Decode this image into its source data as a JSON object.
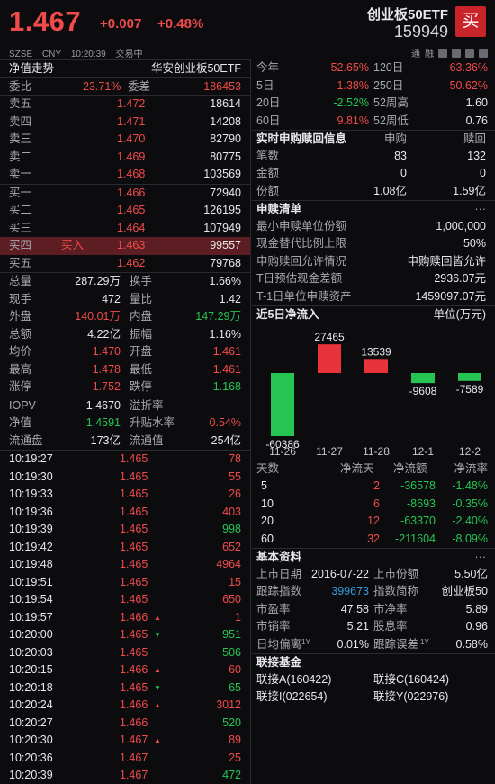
{
  "header": {
    "price": "1.467",
    "change": "+0.007",
    "change_pct": "+0.48%",
    "exchange": "SZSE",
    "currency": "CNY",
    "time": "10:20:39",
    "status": "交易中",
    "name": "创业板50ETF",
    "code": "159949",
    "buy_label": "买",
    "tools": [
      "通",
      "融"
    ]
  },
  "left": {
    "nav_title": "净值走势",
    "nav_fund": "华安创业板50ETF",
    "weibi": {
      "label": "委比",
      "value": "23.71%",
      "label2": "委差",
      "value2": "186453"
    },
    "sells": [
      {
        "label": "卖五",
        "price": "1.472",
        "vol": "18614"
      },
      {
        "label": "卖四",
        "price": "1.471",
        "vol": "14208"
      },
      {
        "label": "卖三",
        "price": "1.470",
        "vol": "82790"
      },
      {
        "label": "卖二",
        "price": "1.469",
        "vol": "80775"
      },
      {
        "label": "卖一",
        "price": "1.468",
        "vol": "103569"
      }
    ],
    "buys": [
      {
        "label": "买一",
        "tag": "",
        "price": "1.466",
        "vol": "72940"
      },
      {
        "label": "买二",
        "tag": "",
        "price": "1.465",
        "vol": "126195"
      },
      {
        "label": "买三",
        "tag": "",
        "price": "1.464",
        "vol": "107949"
      },
      {
        "label": "买四",
        "tag": "买入",
        "price": "1.463",
        "vol": "99557"
      },
      {
        "label": "买五",
        "tag": "",
        "price": "1.462",
        "vol": "79768"
      }
    ],
    "stats": [
      {
        "l1": "总量",
        "v1": "287.29万",
        "c1": "white",
        "l2": "换手",
        "v2": "1.66%",
        "c2": "white"
      },
      {
        "l1": "现手",
        "v1": "472",
        "c1": "white",
        "l2": "量比",
        "v2": "1.42",
        "c2": "white"
      },
      {
        "l1": "外盘",
        "v1": "140.01万",
        "c1": "red",
        "l2": "内盘",
        "v2": "147.29万",
        "c2": "green"
      },
      {
        "l1": "总额",
        "v1": "4.22亿",
        "c1": "white",
        "l2": "振幅",
        "v2": "1.16%",
        "c2": "white"
      },
      {
        "l1": "均价",
        "v1": "1.470",
        "c1": "red",
        "l2": "开盘",
        "v2": "1.461",
        "c2": "red"
      },
      {
        "l1": "最高",
        "v1": "1.478",
        "c1": "red",
        "l2": "最低",
        "v2": "1.461",
        "c2": "red"
      },
      {
        "l1": "涨停",
        "v1": "1.752",
        "c1": "red",
        "l2": "跌停",
        "v2": "1.168",
        "c2": "green"
      }
    ],
    "iopv": [
      {
        "l1": "IOPV",
        "v1": "1.4670",
        "c1": "white",
        "l2": "溢折率",
        "v2": "-",
        "c2": "white"
      },
      {
        "l1": "净值",
        "v1": "1.4591",
        "c1": "green",
        "l2": "升贴水率",
        "v2": "0.54%",
        "c2": "red"
      },
      {
        "l1": "流通盘",
        "v1": "173亿",
        "c1": "white",
        "l2": "流通值",
        "v2": "254亿",
        "c2": "white"
      }
    ],
    "ticks": [
      {
        "time": "10:19:27",
        "price": "1.465",
        "arrow": "",
        "vol": "78",
        "vc": "red"
      },
      {
        "time": "10:19:30",
        "price": "1.465",
        "arrow": "",
        "vol": "55",
        "vc": "red"
      },
      {
        "time": "10:19:33",
        "price": "1.465",
        "arrow": "",
        "vol": "26",
        "vc": "red"
      },
      {
        "time": "10:19:36",
        "price": "1.465",
        "arrow": "",
        "vol": "403",
        "vc": "red"
      },
      {
        "time": "10:19:39",
        "price": "1.465",
        "arrow": "",
        "vol": "998",
        "vc": "green"
      },
      {
        "time": "10:19:42",
        "price": "1.465",
        "arrow": "",
        "vol": "652",
        "vc": "red"
      },
      {
        "time": "10:19:48",
        "price": "1.465",
        "arrow": "",
        "vol": "4964",
        "vc": "red"
      },
      {
        "time": "10:19:51",
        "price": "1.465",
        "arrow": "",
        "vol": "15",
        "vc": "red"
      },
      {
        "time": "10:19:54",
        "price": "1.465",
        "arrow": "",
        "vol": "650",
        "vc": "red"
      },
      {
        "time": "10:19:57",
        "price": "1.466",
        "arrow": "up",
        "vol": "1",
        "vc": "red"
      },
      {
        "time": "10:20:00",
        "price": "1.465",
        "arrow": "down",
        "vol": "951",
        "vc": "green"
      },
      {
        "time": "10:20:03",
        "price": "1.465",
        "arrow": "",
        "vol": "506",
        "vc": "green"
      },
      {
        "time": "10:20:15",
        "price": "1.466",
        "arrow": "up",
        "vol": "60",
        "vc": "red"
      },
      {
        "time": "10:20:18",
        "price": "1.465",
        "arrow": "down",
        "vol": "65",
        "vc": "green"
      },
      {
        "time": "10:20:24",
        "price": "1.466",
        "arrow": "up",
        "vol": "3012",
        "vc": "red"
      },
      {
        "time": "10:20:27",
        "price": "1.466",
        "arrow": "",
        "vol": "520",
        "vc": "green"
      },
      {
        "time": "10:20:30",
        "price": "1.467",
        "arrow": "up",
        "vol": "89",
        "vc": "red"
      },
      {
        "time": "10:20:36",
        "price": "1.467",
        "arrow": "",
        "vol": "25",
        "vc": "red"
      },
      {
        "time": "10:20:39",
        "price": "1.467",
        "arrow": "",
        "vol": "472",
        "vc": "green"
      }
    ]
  },
  "right": {
    "perf": [
      {
        "l1": "今年",
        "v1": "52.65%",
        "c1": "red",
        "l2": "120日",
        "v2": "63.36%",
        "c2": "red"
      },
      {
        "l1": "5日",
        "v1": "1.38%",
        "c1": "red",
        "l2": "250日",
        "v2": "50.62%",
        "c2": "red"
      },
      {
        "l1": "20日",
        "v1": "-2.52%",
        "c1": "green",
        "l2": "52周高",
        "v2": "1.60",
        "c2": "white"
      },
      {
        "l1": "60日",
        "v1": "9.81%",
        "c1": "red",
        "l2": "52周低",
        "v2": "0.76",
        "c2": "white"
      }
    ],
    "realtime": {
      "title": "实时申购赎回信息",
      "col1": "申购",
      "col2": "赎回",
      "rows": [
        {
          "label": "笔数",
          "v1": "83",
          "v2": "132"
        },
        {
          "label": "金额",
          "v1": "0",
          "v2": "0"
        },
        {
          "label": "份额",
          "v1": "1.08亿",
          "v2": "1.59亿"
        }
      ]
    },
    "list": {
      "title": "申赎清单",
      "more": "···",
      "rows": [
        {
          "label": "最小申赎单位份额",
          "value": "1,000,000"
        },
        {
          "label": "现金替代比例上限",
          "value": "50%"
        },
        {
          "label": "申购赎回允许情况",
          "value": "申购赎回皆允许"
        },
        {
          "label": "T日预估现金差额",
          "value": "2936.07元"
        },
        {
          "label": "T-1日单位申赎资产",
          "value": "1459097.07元"
        }
      ]
    },
    "flow": {
      "title": "近5日净流入",
      "unit": "单位(万元)"
    },
    "flow_table": {
      "headers": [
        "天数",
        "净流天",
        "净流额",
        "净流率"
      ],
      "rows": [
        {
          "days": "5",
          "n": "2",
          "amt": "-36578",
          "rate": "-1.48%"
        },
        {
          "days": "10",
          "n": "6",
          "amt": "-8693",
          "rate": "-0.35%"
        },
        {
          "days": "20",
          "n": "12",
          "amt": "-63370",
          "rate": "-2.40%"
        },
        {
          "days": "60",
          "n": "32",
          "amt": "-211604",
          "rate": "-8.09%"
        }
      ]
    },
    "basic": {
      "title": "基本资料",
      "more": "···",
      "rows": [
        {
          "l1": "上市日期",
          "v1": "2016-07-22",
          "c1": "white",
          "l2": "上市份额",
          "v2": "5.50亿",
          "c2": "white",
          "s1": "",
          "s2": ""
        },
        {
          "l1": "跟踪指数",
          "v1": "399673",
          "c1": "blue",
          "l2": "指数简称",
          "v2": "创业板50",
          "c2": "white",
          "s1": "",
          "s2": ""
        },
        {
          "l1": "市盈率",
          "v1": "47.58",
          "c1": "white",
          "l2": "市净率",
          "v2": "5.89",
          "c2": "white",
          "s1": "",
          "s2": ""
        },
        {
          "l1": "市销率",
          "v1": "5.21",
          "c1": "white",
          "l2": "股息率",
          "v2": "0.96",
          "c2": "white",
          "s1": "",
          "s2": ""
        },
        {
          "l1": "日均偏离",
          "v1": "0.01%",
          "c1": "white",
          "l2": "跟踪误差",
          "v2": "0.58%",
          "c2": "white",
          "s1": "1Y",
          "s2": "1Y"
        }
      ]
    },
    "linked": {
      "title": "联接基金",
      "items": [
        "联接A(160422)",
        "联接C(160424)",
        "联接I(022654)",
        "联接Y(022976)"
      ]
    }
  },
  "chart_data": {
    "type": "bar",
    "title": "近5日净流入",
    "unit": "单位(万元)",
    "categories": [
      "11-26",
      "11-27",
      "11-28",
      "12-1",
      "12-2"
    ],
    "values": [
      -60386,
      27465,
      13539,
      -9608,
      -7589
    ],
    "colors": {
      "positive": "#e8333a",
      "negative": "#26c452"
    }
  }
}
